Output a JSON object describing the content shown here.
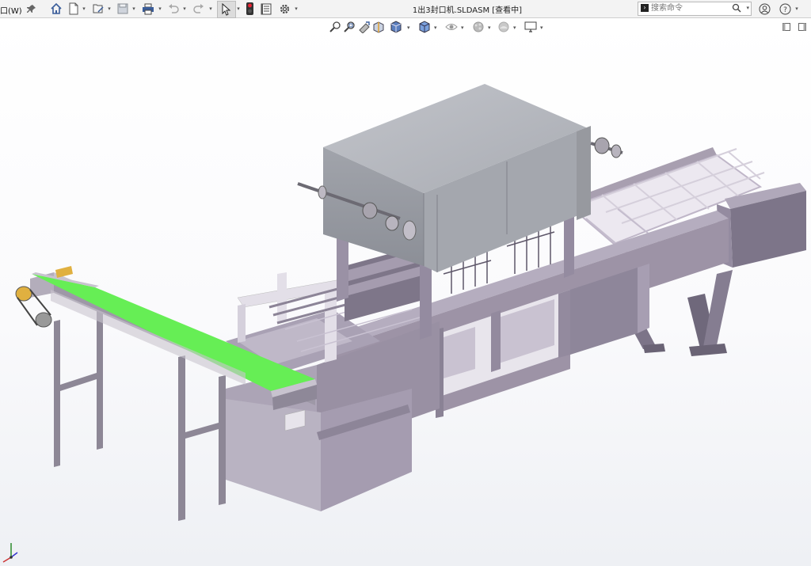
{
  "window_menu": {
    "label": "口(W)"
  },
  "title": "1出3封口机.SLDASM [查看中]",
  "search": {
    "placeholder": "搜索命令"
  },
  "toolbar_icons": [
    "pin-icon",
    "home-icon",
    "new-document-icon",
    "open-file-icon",
    "save-icon",
    "print-icon",
    "undo-icon",
    "redo-icon",
    "select-cursor-icon",
    "traffic-light-icon",
    "file-properties-icon",
    "options-gear-icon"
  ],
  "view_toolbar_icons": [
    "zoom-to-fit-icon",
    "zoom-to-area-icon",
    "previous-view-icon",
    "section-view-icon",
    "view-orientation-icon",
    "display-style-icon",
    "hide-show-items-icon",
    "edit-appearance-icon",
    "apply-scene-icon",
    "view-settings-icon"
  ],
  "right_icons": [
    "help-icon",
    "account-icon"
  ],
  "colors": {
    "accent_green": "#66ee55",
    "machine_body": "#9d93a6",
    "top_housing": "#a9acb3",
    "frame_dark": "#7c7488"
  }
}
